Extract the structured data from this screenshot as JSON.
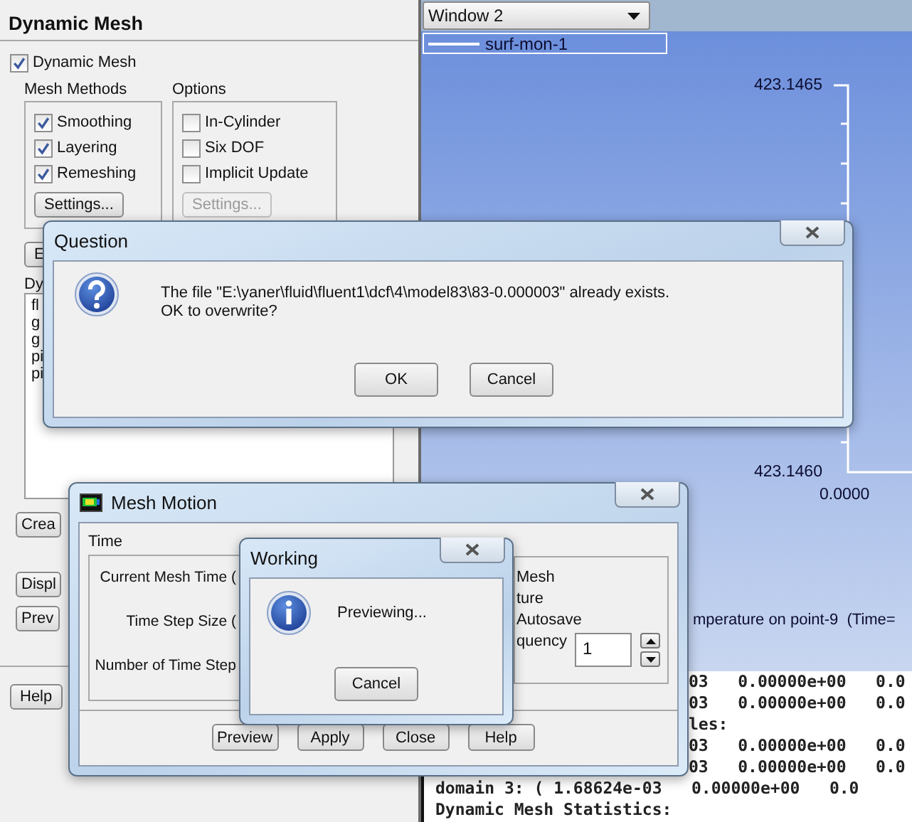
{
  "left_panel": {
    "title": "Dynamic Mesh",
    "dynamic_mesh": {
      "label": "Dynamic Mesh",
      "checked": true
    },
    "mesh_methods": {
      "label": "Mesh Methods",
      "items": [
        {
          "label": "Smoothing",
          "checked": true
        },
        {
          "label": "Layering",
          "checked": true
        },
        {
          "label": "Remeshing",
          "checked": true
        }
      ],
      "settings_button": {
        "label": "Settings...",
        "disabled": false
      }
    },
    "options": {
      "label": "Options",
      "items": [
        {
          "label": "In-Cylinder",
          "checked": false
        },
        {
          "label": "Six DOF",
          "checked": false
        },
        {
          "label": "Implicit Update",
          "checked": false
        }
      ],
      "settings_button": {
        "label": "Settings...",
        "disabled": true
      }
    },
    "cut_button": "E",
    "list_label": "Dy",
    "list_items": [
      "fl",
      "g",
      "g",
      "pi",
      "pi"
    ],
    "create_button": "Crea",
    "lower_buttons": [
      "Displ",
      "Prev"
    ],
    "help_button": "Help"
  },
  "graphics": {
    "window_select": "Window 2",
    "legend": "surf-mon-1",
    "y_labels": [
      "423.1465",
      "423.1460"
    ],
    "x_label": "0.0000",
    "title": "mperature on point-9  (Time="
  },
  "console": {
    "lines": [
      {
        "text": "03   0.00000e+00   0.0",
        "kind": "partial"
      },
      {
        "text": "03   0.00000e+00   0.0",
        "kind": "partial"
      },
      {
        "text": "les:",
        "kind": "partial"
      },
      {
        "text": "03   0.00000e+00   0.0",
        "kind": "partial"
      },
      {
        "text": "03   0.00000e+00   0.0",
        "kind": "partial"
      },
      {
        "text": "domain 3: ( 1.68624e-03   0.00000e+00   0.0",
        "kind": "full"
      },
      {
        "text": "Dynamic Mesh Statistics:",
        "kind": "full"
      }
    ]
  },
  "question_dialog": {
    "title": "Question",
    "message": "The file \"E:\\yaner\\fluid\\fluent1\\dcf\\4\\model83\\83-0.000003\" already exists.\nOK to overwrite?",
    "buttons": [
      "OK",
      "Cancel"
    ]
  },
  "mesh_motion": {
    "title": "Mesh Motion",
    "time_label": "Time",
    "time_fields": [
      "Current Mesh Time (",
      "Time Step Size (",
      "Number of Time Step"
    ],
    "options": [
      "Mesh",
      "ture",
      "Autosave"
    ],
    "frequency_label": "quency",
    "frequency_value": "1",
    "buttons": [
      "Preview",
      "Apply",
      "Close",
      "Help"
    ]
  },
  "working_dialog": {
    "title": "Working",
    "message": "Previewing...",
    "button": "Cancel"
  }
}
